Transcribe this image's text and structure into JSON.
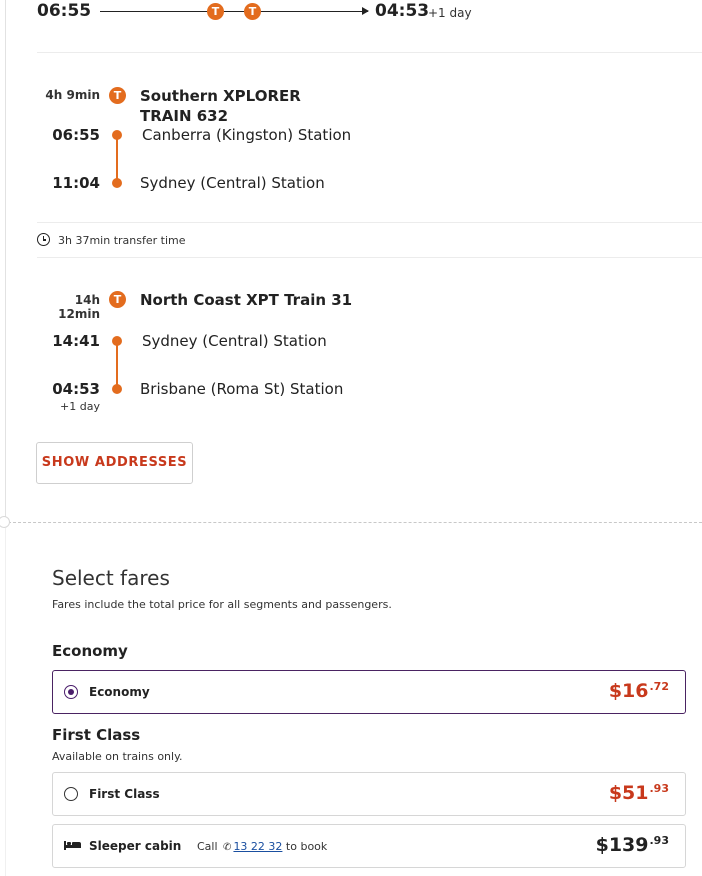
{
  "summary": {
    "departure_time": "06:55",
    "arrival_time": "04:53",
    "arrival_day_offset": "+1 day",
    "train_badge": "T"
  },
  "segments": [
    {
      "duration": "4h 9min",
      "train_name": "Southern XPLORER TRAIN 632",
      "dep_time": "06:55",
      "dep_station": "Canberra (Kingston) Station",
      "arr_time": "11:04",
      "arr_station": "Sydney (Central) Station",
      "arr_day_offset": ""
    },
    {
      "duration": "14h 12min",
      "train_name": "North Coast XPT Train 31",
      "dep_time": "14:41",
      "dep_station": "Sydney (Central) Station",
      "arr_time": "04:53",
      "arr_station": "Brisbane (Roma St) Station",
      "arr_day_offset": "+1 day"
    }
  ],
  "transfer": {
    "text": "3h 37min transfer time"
  },
  "show_addresses_label": "SHOW ADDRESSES",
  "fares": {
    "title": "Select fares",
    "note": "Fares include the total price for all segments and passengers.",
    "economy": {
      "heading": "Economy",
      "options": [
        {
          "label": "Economy",
          "price_dollars": "$16",
          "price_cents": ".72",
          "selected": true
        }
      ]
    },
    "first_class": {
      "heading": "First Class",
      "subtitle": "Available on trains only.",
      "options": [
        {
          "label": "First Class",
          "price_dollars": "$51",
          "price_cents": ".93",
          "selected": false
        },
        {
          "label": "Sleeper cabin",
          "call_prefix": "Call",
          "phone": "13 22 32",
          "call_suffix": "to book",
          "price_dollars": "$139",
          "price_cents": ".93"
        }
      ]
    }
  },
  "colors": {
    "accent_orange": "#e36c1e",
    "price_red": "#c8391c",
    "selected_purple": "#4a1d6b",
    "link_blue": "#1a4fa0"
  },
  "icons": {
    "train": "train-badge-icon",
    "clock": "clock-icon",
    "radio": "radio-icon",
    "bed": "bed-icon",
    "phone": "phone-icon"
  }
}
